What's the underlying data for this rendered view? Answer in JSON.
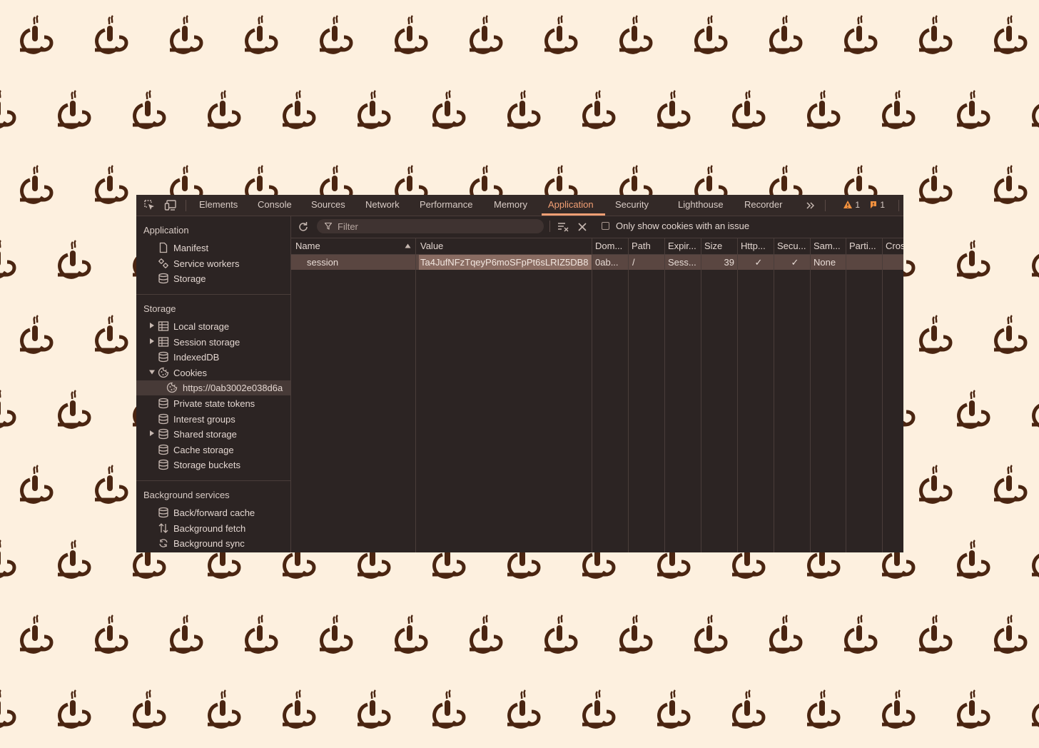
{
  "background": {
    "pattern_icon": "coffee-cup-icon",
    "color": "#fdf0df",
    "icon_color": "#4a2511"
  },
  "toolbar": {
    "inspect_icon": "inspect-element-icon",
    "device_icon": "device-toolbar-icon",
    "tabs": [
      "Elements",
      "Console",
      "Sources",
      "Network",
      "Performance",
      "Memory",
      "Application",
      "Security",
      "Lighthouse",
      "Recorder"
    ],
    "active_tab": "Application",
    "more_icon": "chevron-double-right-icon",
    "warnings_count": "1",
    "issues_count": "1",
    "accent_color": "#f29f74"
  },
  "sidebar": {
    "application": {
      "heading": "Application",
      "items": [
        {
          "label": "Manifest",
          "icon": "document-icon"
        },
        {
          "label": "Service workers",
          "icon": "gears-icon"
        },
        {
          "label": "Storage",
          "icon": "database-icon"
        }
      ]
    },
    "storage": {
      "heading": "Storage",
      "items": [
        {
          "label": "Local storage",
          "icon": "table-icon"
        },
        {
          "label": "Session storage",
          "icon": "table-icon"
        },
        {
          "label": "IndexedDB",
          "icon": "database-icon"
        },
        {
          "label": "Cookies",
          "icon": "cookie-icon"
        },
        {
          "label": "https://0ab3002e038d6a",
          "icon": "cookie-icon"
        },
        {
          "label": "Private state tokens",
          "icon": "database-icon"
        },
        {
          "label": "Interest groups",
          "icon": "database-icon"
        },
        {
          "label": "Shared storage",
          "icon": "database-icon"
        },
        {
          "label": "Cache storage",
          "icon": "database-icon"
        },
        {
          "label": "Storage buckets",
          "icon": "database-icon"
        }
      ]
    },
    "background_services": {
      "heading": "Background services",
      "items": [
        {
          "label": "Back/forward cache",
          "icon": "database-icon"
        },
        {
          "label": "Background fetch",
          "icon": "arrows-updown-icon"
        },
        {
          "label": "Background sync",
          "icon": "sync-icon"
        }
      ]
    }
  },
  "main": {
    "filter_placeholder": "Filter",
    "only_issues_label": "Only show cookies with an issue",
    "columns": [
      "Name",
      "Value",
      "Dom...",
      "Path",
      "Expir...",
      "Size",
      "Http...",
      "Secu...",
      "Sam...",
      "Parti...",
      "Cros"
    ],
    "sorted_column": "Name",
    "rows": [
      {
        "name": "session",
        "value": "Ta4JufNFzTqeyP6moSFpPt6sLRIZ5DB8",
        "domain": "0ab...",
        "path": "/",
        "expires": "Sess...",
        "size": "39",
        "http_only": "✓",
        "secure": "✓",
        "samesite": "None",
        "partition": "",
        "cross_site": ""
      }
    ]
  }
}
